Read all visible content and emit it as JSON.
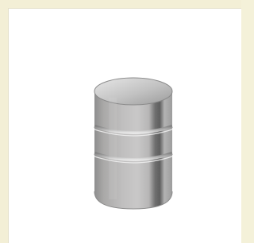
{
  "image": {
    "subject": "brushed-steel-cylinder-knob",
    "colors": {
      "frame_background": "#f3efd6",
      "panel_background": "#ffffff",
      "steel_light": "#d7d7d7",
      "steel_mid": "#b9b9b9",
      "steel_dark": "#8f8f8f"
    }
  }
}
